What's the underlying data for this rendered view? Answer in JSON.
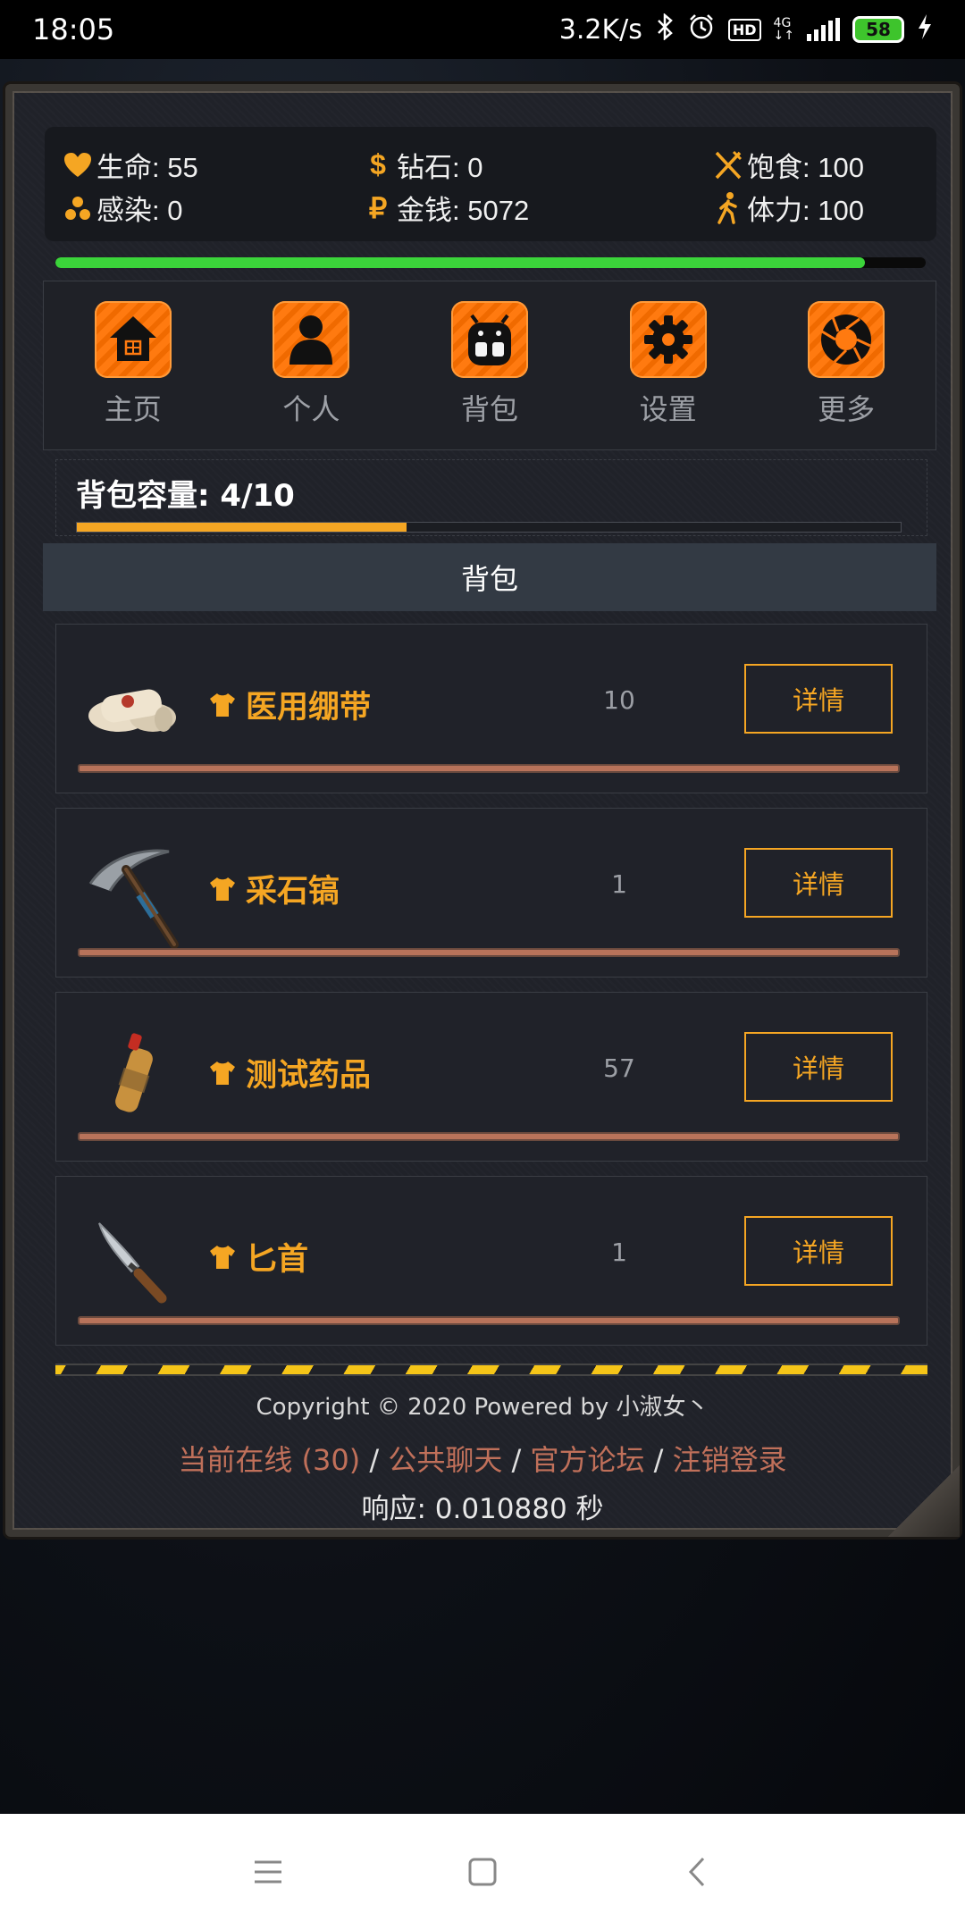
{
  "status_bar": {
    "time": "18:05",
    "net_speed": "3.2K/s",
    "hd": "HD",
    "network": "4G",
    "battery": "58"
  },
  "stats": {
    "hp_label": "生命: 55",
    "diamond_label": "钻石: 0",
    "food_label": "饱食: 100",
    "infection_label": "感染: 0",
    "money_label": "金钱: 5072",
    "stamina_label": "体力: 100",
    "hp_progress": 0.93
  },
  "nav": {
    "items": [
      {
        "label": "主页",
        "icon": "home-icon"
      },
      {
        "label": "个人",
        "icon": "person-icon"
      },
      {
        "label": "背包",
        "icon": "backpack-icon"
      },
      {
        "label": "设置",
        "icon": "gear-icon"
      },
      {
        "label": "更多",
        "icon": "shutter-icon"
      }
    ]
  },
  "capacity": {
    "label": "背包容量: 4/10",
    "used": 4,
    "total": 10
  },
  "section_title": "背包",
  "items": [
    {
      "name": "医用绷带",
      "qty": "10",
      "button": "详情",
      "icon": "bandage-icon"
    },
    {
      "name": "采石镐",
      "qty": "1",
      "button": "详情",
      "icon": "pickaxe-icon"
    },
    {
      "name": "测试药品",
      "qty": "57",
      "button": "详情",
      "icon": "bottle-icon"
    },
    {
      "name": "匕首",
      "qty": "1",
      "button": "详情",
      "icon": "dagger-icon"
    }
  ],
  "footer": {
    "copyright": "Copyright © 2020 Powered by 小淑女丶",
    "online": "当前在线 (30)",
    "chat": "公共聊天",
    "forum": "官方论坛",
    "logout": "注销登录",
    "sep": " / ",
    "response": "响应: 0.010880 秒"
  },
  "colors": {
    "accent": "#f5a623",
    "hp_bar": "#3bd43a",
    "link": "#c0705a",
    "nav_icon": "#ff7a10"
  }
}
